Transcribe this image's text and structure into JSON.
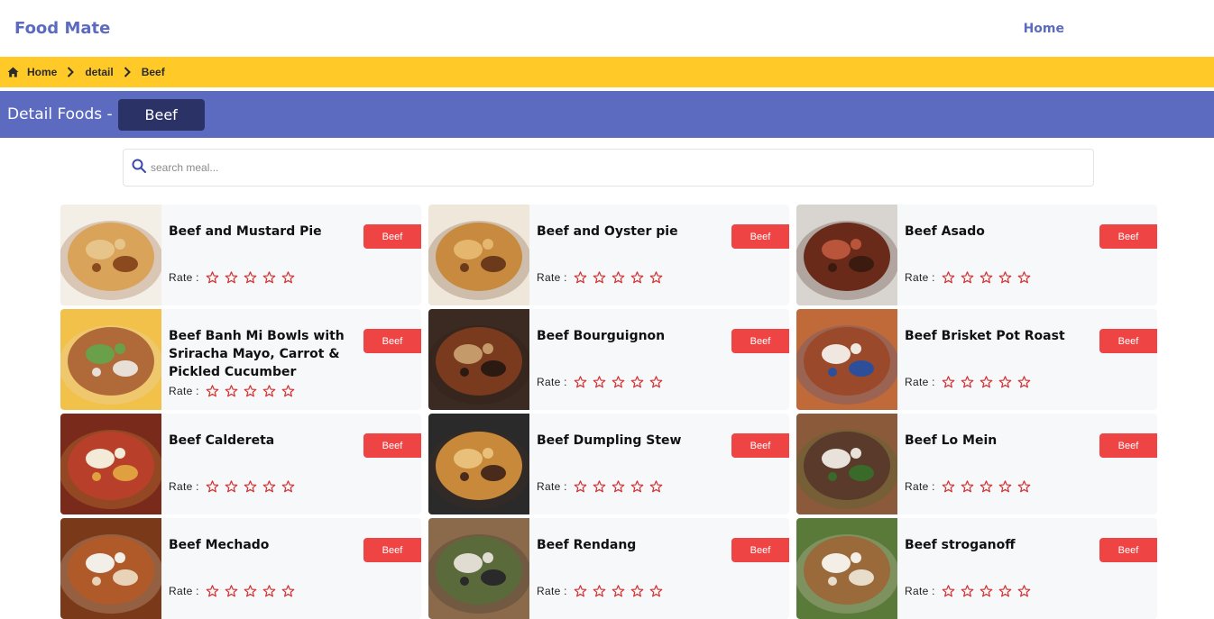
{
  "app": {
    "brand": "Food Mate",
    "nav_home": "Home"
  },
  "breadcrumb": {
    "items": [
      "Home",
      "detail",
      "Beef"
    ]
  },
  "header": {
    "title": "Detail Foods -",
    "category": "Beef"
  },
  "search": {
    "placeholder": "search meal..."
  },
  "rate_label": "Rate :",
  "colors": {
    "primary": "#5c6bc0",
    "breadcrumb_bg": "#ffca28",
    "chip_dark": "#2b3266",
    "badge": "#ef4444",
    "star": "#d32f2f"
  },
  "meals": [
    {
      "name": "Beef and Mustard Pie",
      "category": "Beef",
      "rating": 0
    },
    {
      "name": "Beef and Oyster pie",
      "category": "Beef",
      "rating": 0
    },
    {
      "name": "Beef Asado",
      "category": "Beef",
      "rating": 0
    },
    {
      "name": "Beef Banh Mi Bowls with Sriracha Mayo, Carrot & Pickled Cucumber",
      "category": "Beef",
      "rating": 0
    },
    {
      "name": "Beef Bourguignon",
      "category": "Beef",
      "rating": 0
    },
    {
      "name": "Beef Brisket Pot Roast",
      "category": "Beef",
      "rating": 0
    },
    {
      "name": "Beef Caldereta",
      "category": "Beef",
      "rating": 0
    },
    {
      "name": "Beef Dumpling Stew",
      "category": "Beef",
      "rating": 0
    },
    {
      "name": "Beef Lo Mein",
      "category": "Beef",
      "rating": 0
    },
    {
      "name": "Beef Mechado",
      "category": "Beef",
      "rating": 0
    },
    {
      "name": "Beef Rendang",
      "category": "Beef",
      "rating": 0
    },
    {
      "name": "Beef stroganoff",
      "category": "Beef",
      "rating": 0
    }
  ]
}
